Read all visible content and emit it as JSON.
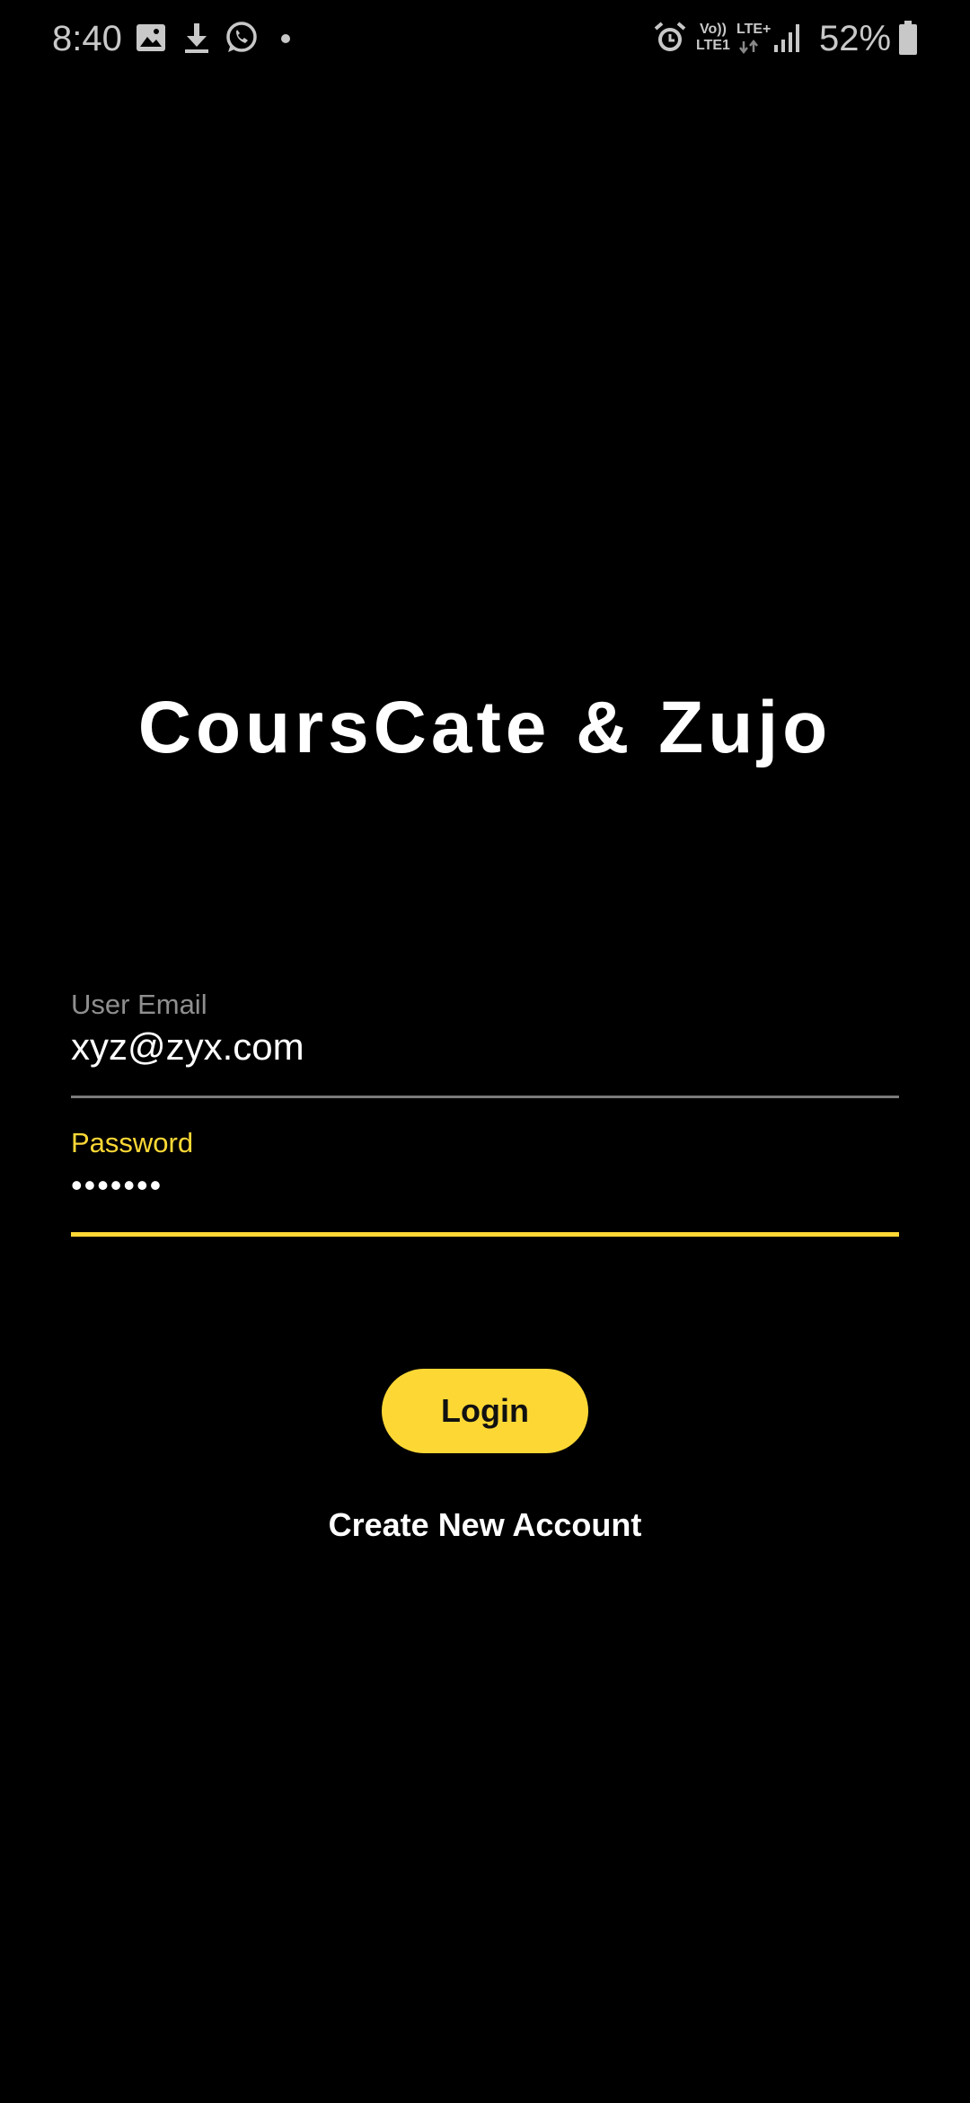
{
  "status_bar": {
    "time": "8:40",
    "left_icons": [
      "image-icon",
      "download-icon",
      "whatsapp-icon",
      "dot-icon"
    ],
    "right_icons": [
      "alarm-icon",
      "volte-icon",
      "signal-icon",
      "battery-icon"
    ],
    "volte_label": "Vo))",
    "lte_plus_label": "LTE+",
    "lte1_label": "LTE1",
    "battery_percent": "52%"
  },
  "app": {
    "title": "CoursCate & Zujo"
  },
  "login_form": {
    "email": {
      "label": "User Email",
      "value": "xyz@zyx.com"
    },
    "password": {
      "label": "Password",
      "value": "•••••••"
    },
    "login_label": "Login",
    "create_account_label": "Create New Account"
  },
  "colors": {
    "background": "#000000",
    "accent": "#fdd835",
    "text": "#ffffff",
    "muted": "#8f8f8f"
  }
}
